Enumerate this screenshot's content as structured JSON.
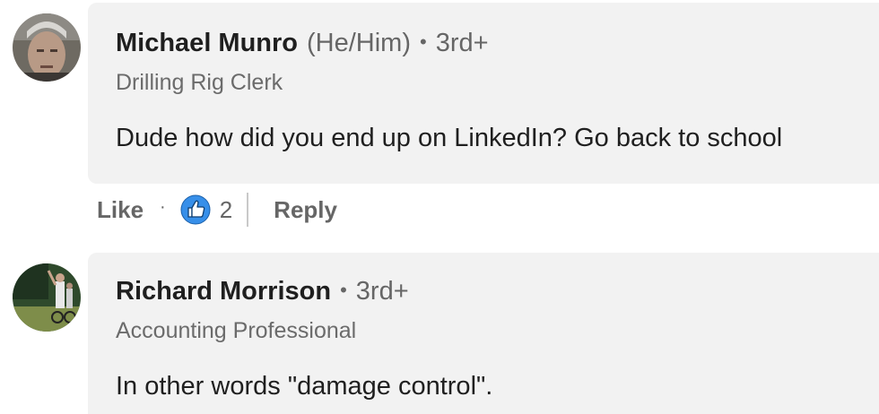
{
  "comments": [
    {
      "author": "Michael Munro",
      "pronouns": "(He/Him)",
      "degree": "3rd+",
      "headline": "Drilling Rig Clerk",
      "text": "Dude how did you end up on LinkedIn? Go back to school",
      "actions": {
        "like_label": "Like",
        "reaction_icon": "thumbs-up-icon",
        "reaction_count": "2",
        "reply_label": "Reply"
      }
    },
    {
      "author": "Richard Morrison",
      "degree": "3rd+",
      "headline": "Accounting Professional",
      "text": "In other words \"damage control\"."
    }
  ],
  "separator": "•",
  "action_separator": "·",
  "colors": {
    "bubble_bg": "#f2f2f2",
    "reaction_blue": "#378fe9",
    "text_primary": "#1f1f1f",
    "text_secondary": "#666666"
  }
}
